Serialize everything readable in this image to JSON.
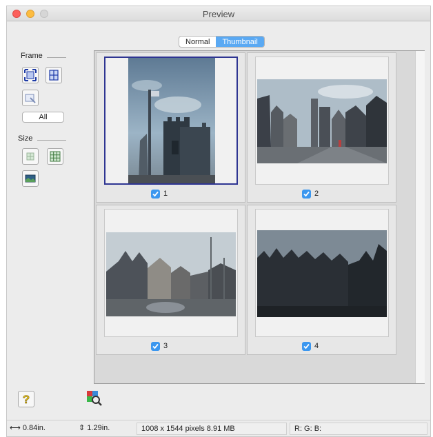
{
  "window": {
    "title": "Preview"
  },
  "view_toggle": {
    "normal_label": "Normal",
    "thumbnail_label": "Thumbnail",
    "selected": "Thumbnail"
  },
  "frame_group": {
    "label": "Frame",
    "all_label": "All"
  },
  "size_group": {
    "label": "Size"
  },
  "thumbnails": [
    {
      "number": "1",
      "checked": true,
      "selected": true
    },
    {
      "number": "2",
      "checked": true,
      "selected": false
    },
    {
      "number": "3",
      "checked": true,
      "selected": false
    },
    {
      "number": "4",
      "checked": true,
      "selected": false
    }
  ],
  "status": {
    "width": "0.84in.",
    "height": "1.29in.",
    "pixels": "1008 x 1544 pixels 8.91 MB",
    "rgb": "R: G: B:"
  },
  "colors": {
    "selection_border": "#2e3592",
    "checkbox": "#3b97ef",
    "segment_active": "#5aa9f3"
  }
}
